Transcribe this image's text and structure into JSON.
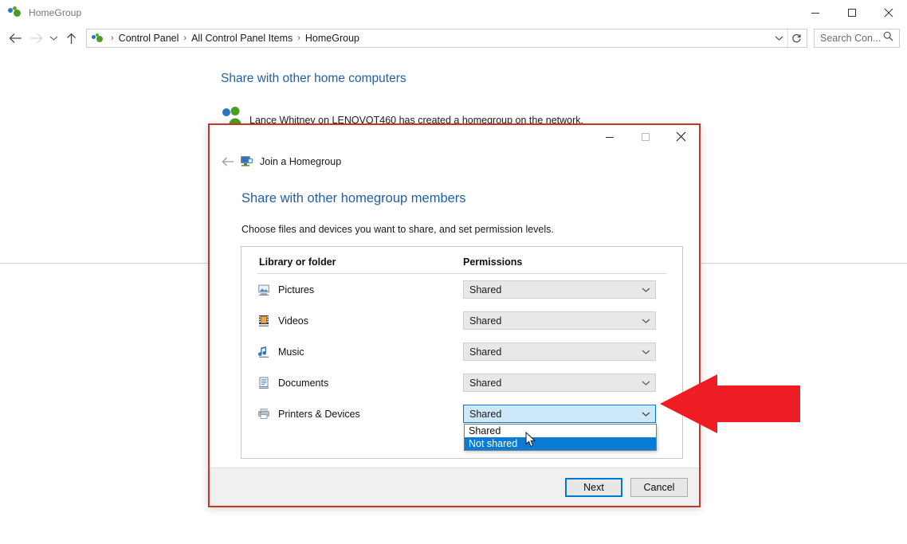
{
  "explorer": {
    "title": "HomeGroup",
    "title_icon": "homegroup-icon",
    "window_controls": {
      "minimize": "minimize-icon",
      "maximize": "maximize-icon",
      "close": "close-icon"
    },
    "nav": {
      "back": "back-arrow-icon",
      "forward": "forward-arrow-icon",
      "recent": "chevron-down-icon",
      "up": "up-arrow-icon"
    },
    "breadcrumb": {
      "icon": "homegroup-icon",
      "items": [
        "Control Panel",
        "All Control Panel Items",
        "HomeGroup"
      ],
      "separator": "›",
      "caret": "chevron-down-icon",
      "refresh": "refresh-icon"
    },
    "search": {
      "placeholder": "Search Con...",
      "icon": "search-icon"
    },
    "content": {
      "heading": "Share with other home computers",
      "people_icon": "homegroup-people-icon",
      "notice": "Lance Whitney on LENOVOT460 has created a homegroup on the network."
    }
  },
  "dialog": {
    "window_controls": {
      "minimize": "minimize-icon",
      "maximize": "maximize-icon",
      "close": "close-icon"
    },
    "back_icon": "back-arrow-icon",
    "app_icon": "join-homegroup-icon",
    "app_title": "Join a Homegroup",
    "heading": "Share with other homegroup members",
    "subtitle": "Choose files and devices you want to share, and set permission levels.",
    "table": {
      "columns": [
        "Library or folder",
        "Permissions"
      ],
      "rows": [
        {
          "icon": "pictures-icon",
          "label": "Pictures",
          "permission": "Shared",
          "active": false
        },
        {
          "icon": "videos-icon",
          "label": "Videos",
          "permission": "Shared",
          "active": false
        },
        {
          "icon": "music-icon",
          "label": "Music",
          "permission": "Shared",
          "active": false
        },
        {
          "icon": "documents-icon",
          "label": "Documents",
          "permission": "Shared",
          "active": false
        },
        {
          "icon": "printer-icon",
          "label": "Printers & Devices",
          "permission": "Shared",
          "active": true
        }
      ]
    },
    "dropdown": {
      "open": true,
      "options": [
        "Shared",
        "Not shared"
      ],
      "highlighted": "Not shared",
      "cursor": "mouse-pointer-icon"
    },
    "buttons": {
      "next": "Next",
      "cancel": "Cancel"
    }
  },
  "annotation": {
    "arrow": "red-left-arrow",
    "color": "#ee1c23"
  }
}
